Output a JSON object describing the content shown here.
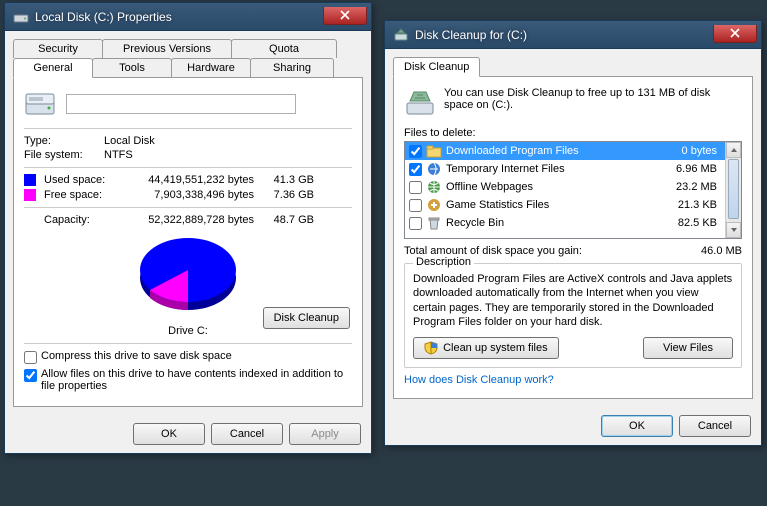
{
  "props": {
    "title": "Local Disk (C:) Properties",
    "tabs_upper": [
      "Security",
      "Previous Versions",
      "Quota"
    ],
    "tabs_lower": [
      "General",
      "Tools",
      "Hardware",
      "Sharing"
    ],
    "active_tab": "General",
    "name_value": "",
    "type_label": "Type:",
    "type_value": "Local Disk",
    "fs_label": "File system:",
    "fs_value": "NTFS",
    "used_label": "Used space:",
    "used_bytes": "44,419,551,232 bytes",
    "used_gb": "41.3 GB",
    "used_color": "#0000ff",
    "free_label": "Free space:",
    "free_bytes": "7,903,338,496 bytes",
    "free_gb": "7.36 GB",
    "free_color": "#ff00ff",
    "cap_label": "Capacity:",
    "cap_bytes": "52,322,889,728 bytes",
    "cap_gb": "48.7 GB",
    "drive_caption": "Drive C:",
    "cleanup_btn": "Disk Cleanup",
    "compress_label": "Compress this drive to save disk space",
    "index_label": "Allow files on this drive to have contents indexed in addition to file properties",
    "ok": "OK",
    "cancel": "Cancel",
    "apply": "Apply"
  },
  "dc": {
    "title": "Disk Cleanup for  (C:)",
    "tab": "Disk Cleanup",
    "top_text": "You can use Disk Cleanup to free up to 131 MB of disk space on  (C:).",
    "files_label": "Files to delete:",
    "files": [
      {
        "checked": true,
        "name": "Downloaded Program Files",
        "size": "0 bytes",
        "icon": "folder",
        "selected": true
      },
      {
        "checked": true,
        "name": "Temporary Internet Files",
        "size": "6.96 MB",
        "icon": "ie"
      },
      {
        "checked": false,
        "name": "Offline Webpages",
        "size": "23.2 MB",
        "icon": "globe"
      },
      {
        "checked": false,
        "name": "Game Statistics Files",
        "size": "21.3 KB",
        "icon": "game"
      },
      {
        "checked": false,
        "name": "Recycle Bin",
        "size": "82.5 KB",
        "icon": "bin"
      }
    ],
    "total_label": "Total amount of disk space you gain:",
    "total_value": "46.0 MB",
    "desc_legend": "Description",
    "desc_text": "Downloaded Program Files are ActiveX controls and Java applets downloaded automatically from the Internet when you view certain pages. They are temporarily stored in the Downloaded Program Files folder on your hard disk.",
    "cleanup_sys": "Clean up system files",
    "view_files": "View Files",
    "help_link": "How does Disk Cleanup work?",
    "ok": "OK",
    "cancel": "Cancel"
  }
}
